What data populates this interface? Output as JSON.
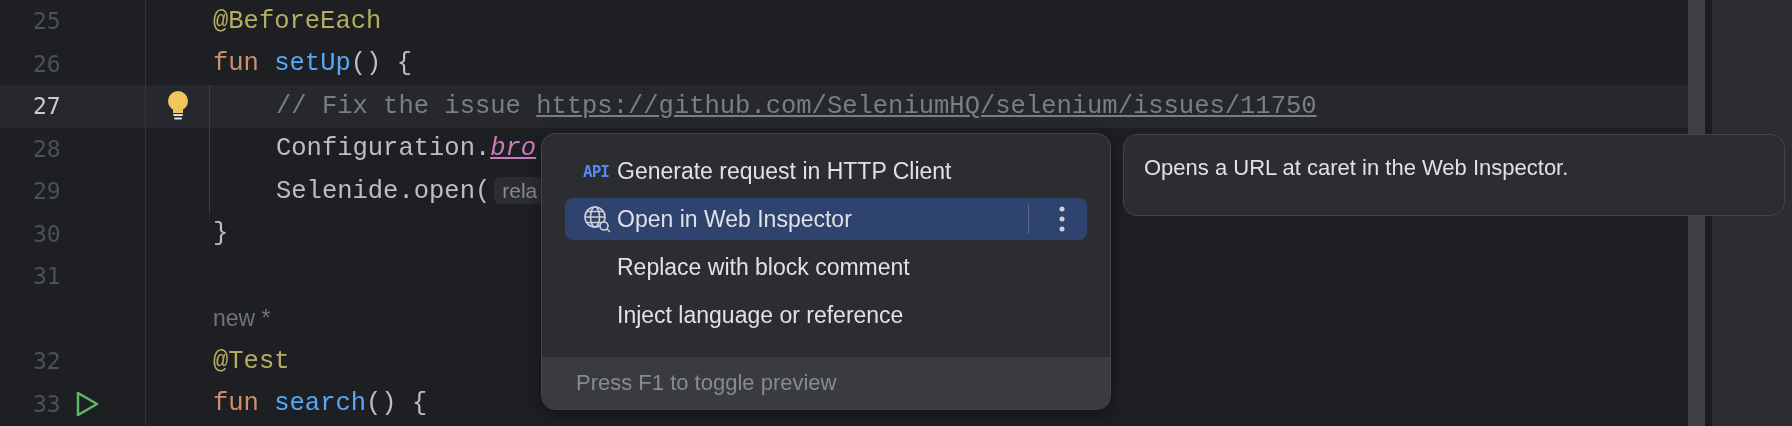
{
  "editor": {
    "lines": [
      {
        "kind": "code",
        "number": "25",
        "current": false,
        "tokens": [
          {
            "kind": "annotation",
            "text": "@BeforeEach"
          }
        ]
      },
      {
        "kind": "code",
        "number": "26",
        "current": false,
        "tokens": [
          {
            "kind": "keyword",
            "text": "fun "
          },
          {
            "kind": "function",
            "text": "setUp"
          },
          {
            "kind": "plain",
            "text": "() {"
          }
        ],
        "children": [
          {
            "kind": "intention",
            "number": "27",
            "current": true,
            "tokens": [
              {
                "kind": "comment",
                "text": "// Fix the issue "
              },
              {
                "kind": "link",
                "text": "https://github.com/SeleniumHQ/selenium/issues/11750"
              }
            ]
          },
          {
            "kind": "code",
            "number": "28",
            "current": false,
            "tokens": [
              {
                "kind": "plain",
                "text": "Configuration."
              },
              {
                "kind": "property",
                "text": "bro"
              }
            ]
          },
          {
            "kind": "code",
            "number": "29",
            "current": false,
            "tokens": [
              {
                "kind": "plain",
                "text": "Selenide.open("
              },
              {
                "kind": "inlay",
                "text": "rela"
              }
            ]
          }
        ]
      },
      {
        "kind": "code",
        "number": "30",
        "current": false,
        "tokens": [
          {
            "kind": "plain",
            "text": "}"
          }
        ]
      },
      {
        "kind": "code",
        "number": "31",
        "current": false
      },
      {
        "kind": "author_hint",
        "text": "new *"
      },
      {
        "kind": "code",
        "number": "32",
        "current": false,
        "tokens": [
          {
            "kind": "annotation",
            "text": "@Test"
          }
        ]
      },
      {
        "kind": "runnable",
        "number": "33",
        "current": false,
        "tokens": [
          {
            "kind": "keyword",
            "text": "fun "
          },
          {
            "kind": "function",
            "text": "search"
          },
          {
            "kind": "plain",
            "text": "() {"
          }
        ]
      }
    ]
  },
  "intention_popup": {
    "items": [
      {
        "kind": "api",
        "label": "Generate request in HTTP Client",
        "selected": false,
        "icon_text": "API",
        "has_more": false
      },
      {
        "kind": "web",
        "label": "Open in Web Inspector",
        "selected": true,
        "has_more": true
      },
      {
        "kind": "plain",
        "label": "Replace with block comment",
        "selected": false,
        "has_more": false
      },
      {
        "kind": "plain",
        "label": "Inject language or reference",
        "selected": false,
        "has_more": false
      }
    ],
    "footer": "Press F1 to toggle preview"
  },
  "tooltip": {
    "text": "Opens a URL at caret in the Web Inspector."
  }
}
